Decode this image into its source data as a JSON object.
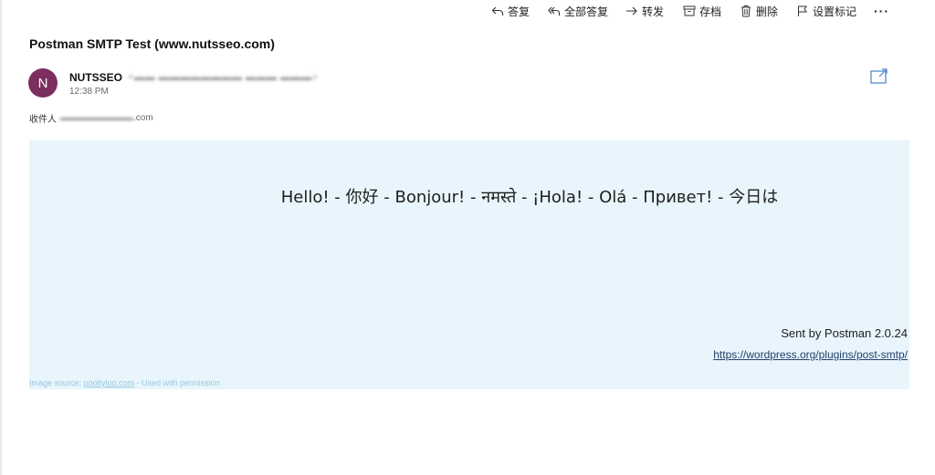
{
  "toolbar": {
    "reply": "答复",
    "reply_all": "全部答复",
    "forward": "转发",
    "archive": "存档",
    "delete": "删除",
    "flag": "设置标记",
    "more": "···"
  },
  "message": {
    "subject": "Postman SMTP Test (www.nutsseo.com)",
    "sender_initial": "N",
    "sender_name": "NUTSSEO",
    "sender_email_obscured": "<▬▬ ▬▬▬▬▬▬▬▬ ▬▬▬ ▬▬▬>",
    "time": "12:38 PM",
    "recipient_label": "收件人",
    "recipient_obscured": "▬▬▬▬▬▬▬▬",
    "recipient_domain": ".com"
  },
  "body": {
    "greeting": "Hello! - 你好 - Bonjour! - नमस्ते - ¡Hola! - Olá - Привет! - 今日は",
    "sent_by": "Sent by Postman 2.0.24",
    "link": "https://wordpress.org/plugins/post-smtp/"
  },
  "footer": {
    "image_source_prefix": "Image source: ",
    "image_source_link": "pooltyloo.com",
    "image_source_suffix": " - Used with permission"
  },
  "colors": {
    "avatar_bg": "#7c2e5f",
    "body_bg": "#e8f5fc",
    "link": "#1f3e67"
  }
}
